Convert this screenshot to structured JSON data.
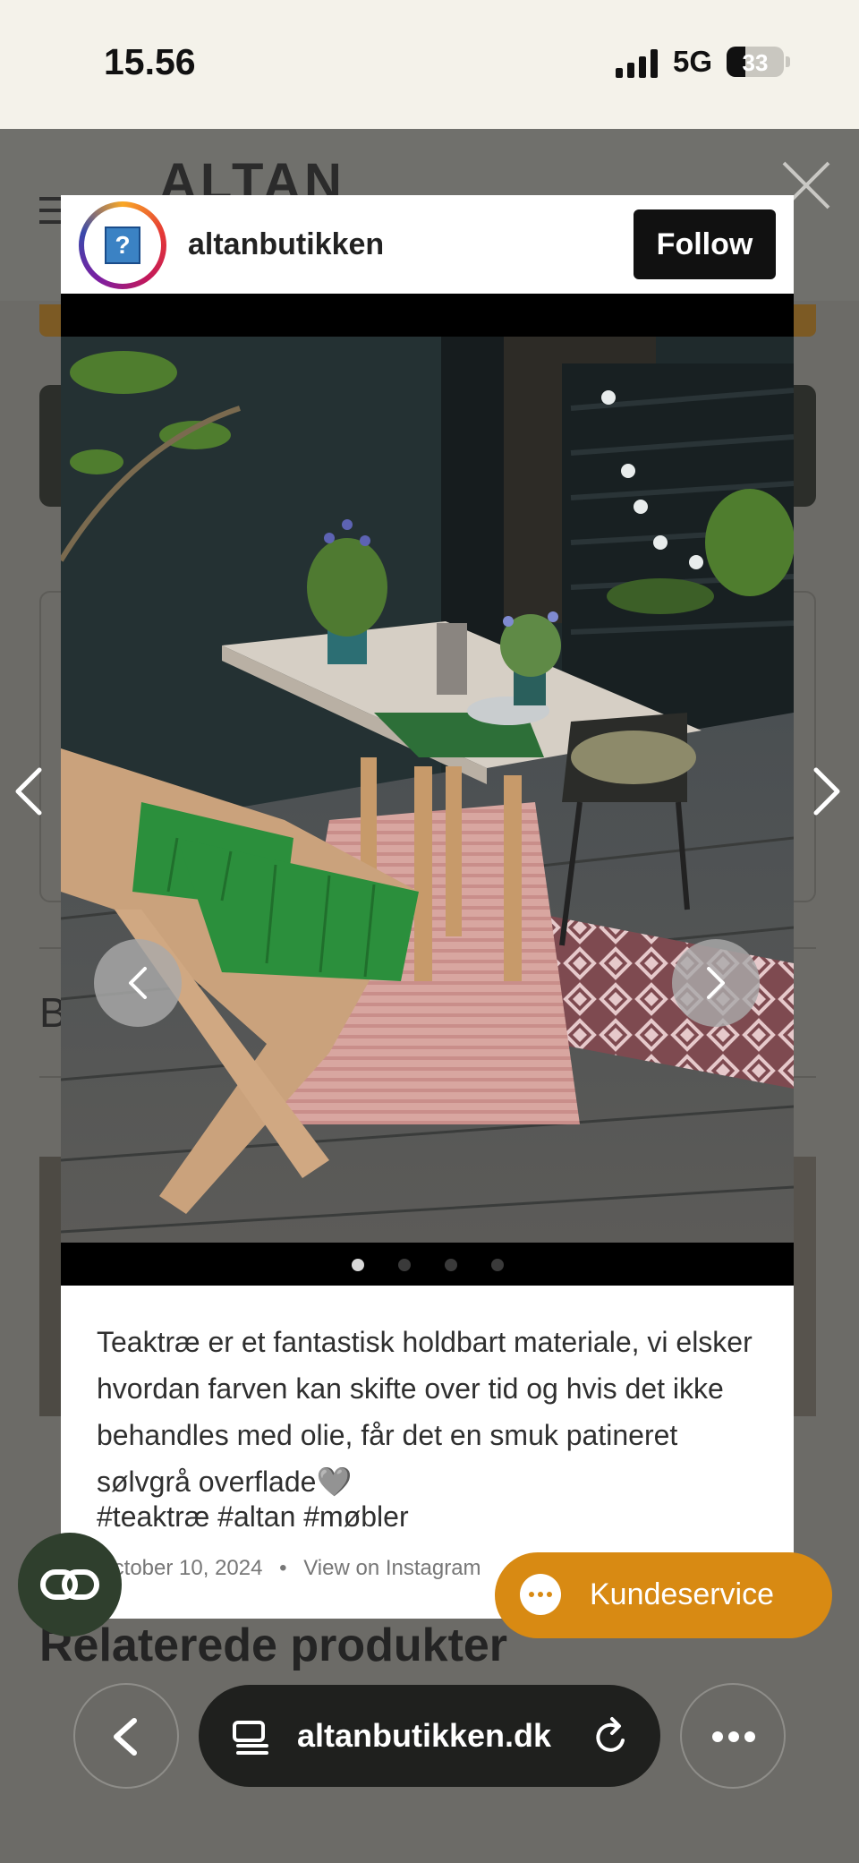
{
  "status_bar": {
    "time": "15.56",
    "network": "5G",
    "battery": "33",
    "battery_level": 0.33
  },
  "background_page": {
    "logo": "ALTAN",
    "section_letter": "B",
    "related_heading": "Relaterede produkter"
  },
  "instagram_modal": {
    "username": "altanbutikken",
    "follow_label": "Follow",
    "caption": "Teaktræ er et fantastisk holdbart materiale, vi elsker hvordan farven kan skifte over tid og hvis det ikke behandles med olie, får det en smuk patineret sølvgrå overflade🩶",
    "hashtags": "#teaktræ #altan #møbler",
    "date": "October 10, 2024",
    "separator": "•",
    "view_link": "View on Instagram",
    "slide_count": 4,
    "active_slide": 1
  },
  "floating": {
    "kundeservice_label": "Kundeservice"
  },
  "browser": {
    "url": "altanbutikken.dk"
  },
  "colors": {
    "accent_orange": "#d88a13",
    "follow_bg": "#111111",
    "overlay": "#6c6b67"
  }
}
